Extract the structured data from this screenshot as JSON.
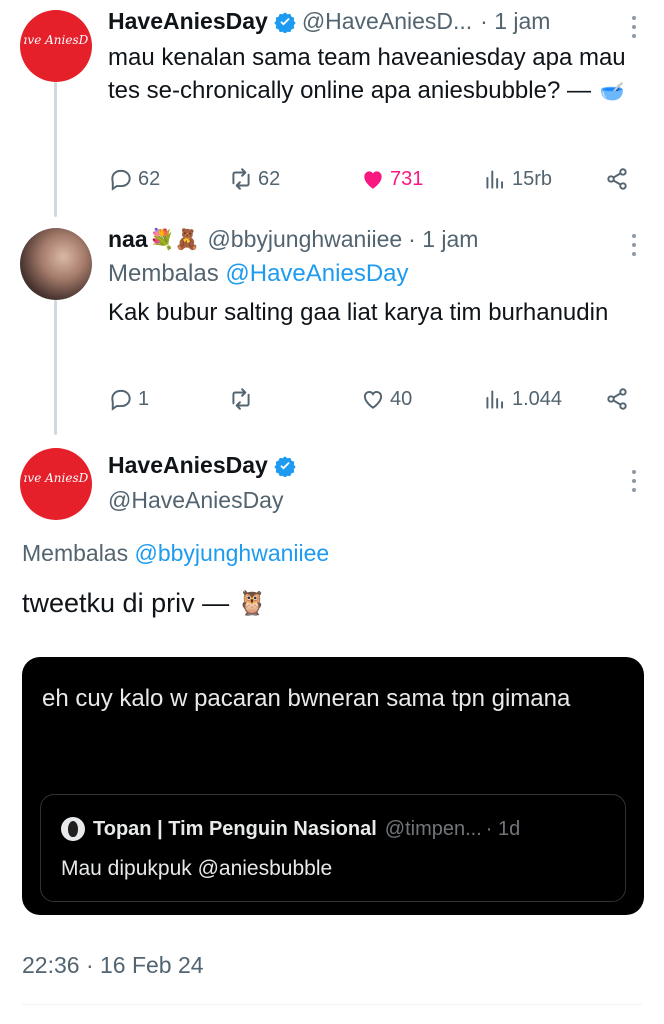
{
  "tweet1": {
    "name": "HaveAniesDay",
    "handle": "@HaveAniesD...",
    "time": "· 1 jam",
    "text": "mau kenalan sama team haveaniesday apa mau tes se-chronically online apa aniesbubble? —",
    "emoji": "🥣",
    "metrics": {
      "replies": "62",
      "retweets": "62",
      "likes": "731",
      "views": "15rb"
    },
    "avatar_logo": "Have AniesDay"
  },
  "tweet2": {
    "name": "naa",
    "name_emojis": "💐🧸",
    "handle": "@bbyjunghwaniiee",
    "time": "· 1 jam",
    "reply_label": "Membalas",
    "reply_handle": "@HaveAniesDay",
    "text": "Kak bubur salting gaa liat karya tim burhanudin",
    "metrics": {
      "replies": "1",
      "retweets": "",
      "likes": "40",
      "views": "1.044"
    }
  },
  "main": {
    "name": "HaveAniesDay",
    "handle": "@HaveAniesDay",
    "reply_label": "Membalas",
    "reply_handle": "@bbyjunghwaniiee",
    "text": "tweetku di priv —",
    "emoji": "🦉",
    "timestamp": "22:36 · 16 Feb 24",
    "avatar_logo": "Have AniesDay"
  },
  "embed": {
    "text": "eh cuy kalo w pacaran bwneran sama tpn gimana",
    "quote": {
      "name": "Topan | Tim Penguin Nasional",
      "handle": "@timpen...",
      "time": "· 1d",
      "text": "Mau dipukpuk @aniesbubble"
    }
  },
  "colors": {
    "brand_red": "#e5202b",
    "like_pink": "#f91880",
    "link_blue": "#1d9bf0",
    "muted": "#536471"
  },
  "icons": [
    "reply-icon",
    "retweet-icon",
    "heart-icon",
    "views-icon",
    "share-icon",
    "verified-icon",
    "more-icon"
  ]
}
